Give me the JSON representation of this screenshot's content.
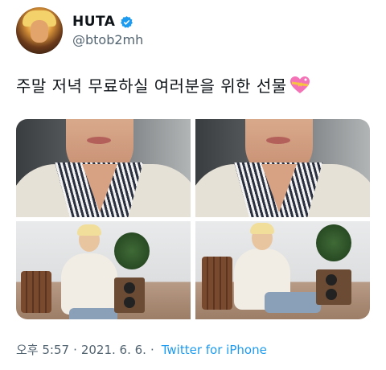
{
  "user": {
    "display_name": "HUTA",
    "handle": "@btob2mh",
    "verified": true
  },
  "tweet": {
    "text": "주말 저녁 무료하실 여러분을 위한 선물",
    "emoji": "sparkling-heart-icon"
  },
  "footer": {
    "time": "오후 5:57",
    "date": "2021. 6. 6.",
    "separator": "·",
    "source": "Twitter for iPhone"
  },
  "colors": {
    "link": "#1d9bf0",
    "meta": "#536471",
    "text": "#0f1419"
  }
}
